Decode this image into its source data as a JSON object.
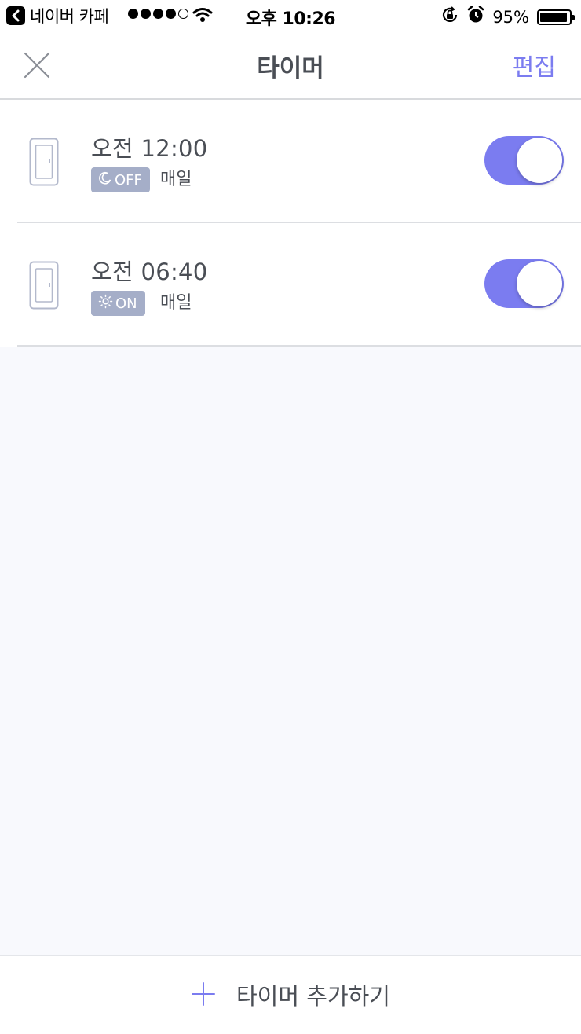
{
  "status_bar": {
    "app_name": "네이버 카페",
    "time": "오후 10:26",
    "battery_percent": "95%",
    "battery_level": 0.95,
    "signal_bars": 4,
    "signal_max": 5
  },
  "nav": {
    "title": "타이머",
    "edit_label": "편집"
  },
  "timers": [
    {
      "time": "오전 12:00",
      "action_label": "OFF",
      "action_icon": "moon-icon",
      "repeat": "매일",
      "enabled": true
    },
    {
      "time": "오전 06:40",
      "action_label": "ON",
      "action_icon": "sun-icon",
      "repeat": "매일",
      "enabled": true
    }
  ],
  "bottom": {
    "add_label": "타이머 추가하기"
  },
  "colors": {
    "accent": "#7b7cf0",
    "badge": "#a5aec8",
    "background": "#f8f9fd",
    "text": "#4a4e55"
  }
}
